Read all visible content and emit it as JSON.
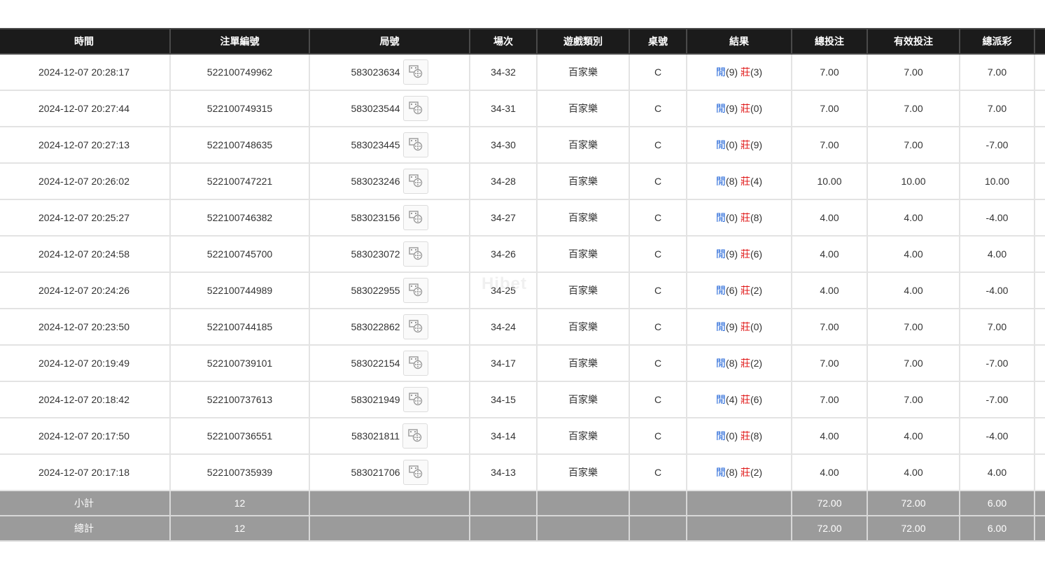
{
  "headers": [
    "時間",
    "注單編號",
    "局號",
    "場次",
    "遊戲類別",
    "桌號",
    "結果",
    "總投注",
    "有效投注",
    "總派彩",
    ""
  ],
  "rows": [
    {
      "time": "2024-12-07 20:28:17",
      "bet_no": "522100749962",
      "round": "583023634",
      "shoe": "34-32",
      "game": "百家樂",
      "table": "C",
      "p_label": "閒",
      "p_val": "(9)",
      "b_label": "莊",
      "b_val": "(3)",
      "total_bet": "7.00",
      "valid_bet": "7.00",
      "payout": "7.00"
    },
    {
      "time": "2024-12-07 20:27:44",
      "bet_no": "522100749315",
      "round": "583023544",
      "shoe": "34-31",
      "game": "百家樂",
      "table": "C",
      "p_label": "閒",
      "p_val": "(9)",
      "b_label": "莊",
      "b_val": "(0)",
      "total_bet": "7.00",
      "valid_bet": "7.00",
      "payout": "7.00"
    },
    {
      "time": "2024-12-07 20:27:13",
      "bet_no": "522100748635",
      "round": "583023445",
      "shoe": "34-30",
      "game": "百家樂",
      "table": "C",
      "p_label": "閒",
      "p_val": "(0)",
      "b_label": "莊",
      "b_val": "(9)",
      "total_bet": "7.00",
      "valid_bet": "7.00",
      "payout": "-7.00"
    },
    {
      "time": "2024-12-07 20:26:02",
      "bet_no": "522100747221",
      "round": "583023246",
      "shoe": "34-28",
      "game": "百家樂",
      "table": "C",
      "p_label": "閒",
      "p_val": "(8)",
      "b_label": "莊",
      "b_val": "(4)",
      "total_bet": "10.00",
      "valid_bet": "10.00",
      "payout": "10.00"
    },
    {
      "time": "2024-12-07 20:25:27",
      "bet_no": "522100746382",
      "round": "583023156",
      "shoe": "34-27",
      "game": "百家樂",
      "table": "C",
      "p_label": "閒",
      "p_val": "(0)",
      "b_label": "莊",
      "b_val": "(8)",
      "total_bet": "4.00",
      "valid_bet": "4.00",
      "payout": "-4.00"
    },
    {
      "time": "2024-12-07 20:24:58",
      "bet_no": "522100745700",
      "round": "583023072",
      "shoe": "34-26",
      "game": "百家樂",
      "table": "C",
      "p_label": "閒",
      "p_val": "(9)",
      "b_label": "莊",
      "b_val": "(6)",
      "total_bet": "4.00",
      "valid_bet": "4.00",
      "payout": "4.00"
    },
    {
      "time": "2024-12-07 20:24:26",
      "bet_no": "522100744989",
      "round": "583022955",
      "shoe": "34-25",
      "game": "百家樂",
      "table": "C",
      "p_label": "閒",
      "p_val": "(6)",
      "b_label": "莊",
      "b_val": "(2)",
      "total_bet": "4.00",
      "valid_bet": "4.00",
      "payout": "-4.00"
    },
    {
      "time": "2024-12-07 20:23:50",
      "bet_no": "522100744185",
      "round": "583022862",
      "shoe": "34-24",
      "game": "百家樂",
      "table": "C",
      "p_label": "閒",
      "p_val": "(9)",
      "b_label": "莊",
      "b_val": "(0)",
      "total_bet": "7.00",
      "valid_bet": "7.00",
      "payout": "7.00"
    },
    {
      "time": "2024-12-07 20:19:49",
      "bet_no": "522100739101",
      "round": "583022154",
      "shoe": "34-17",
      "game": "百家樂",
      "table": "C",
      "p_label": "閒",
      "p_val": "(8)",
      "b_label": "莊",
      "b_val": "(2)",
      "total_bet": "7.00",
      "valid_bet": "7.00",
      "payout": "-7.00"
    },
    {
      "time": "2024-12-07 20:18:42",
      "bet_no": "522100737613",
      "round": "583021949",
      "shoe": "34-15",
      "game": "百家樂",
      "table": "C",
      "p_label": "閒",
      "p_val": "(4)",
      "b_label": "莊",
      "b_val": "(6)",
      "total_bet": "7.00",
      "valid_bet": "7.00",
      "payout": "-7.00"
    },
    {
      "time": "2024-12-07 20:17:50",
      "bet_no": "522100736551",
      "round": "583021811",
      "shoe": "34-14",
      "game": "百家樂",
      "table": "C",
      "p_label": "閒",
      "p_val": "(0)",
      "b_label": "莊",
      "b_val": "(8)",
      "total_bet": "4.00",
      "valid_bet": "4.00",
      "payout": "-4.00"
    },
    {
      "time": "2024-12-07 20:17:18",
      "bet_no": "522100735939",
      "round": "583021706",
      "shoe": "34-13",
      "game": "百家樂",
      "table": "C",
      "p_label": "閒",
      "p_val": "(8)",
      "b_label": "莊",
      "b_val": "(2)",
      "total_bet": "4.00",
      "valid_bet": "4.00",
      "payout": "4.00"
    }
  ],
  "subtotal": {
    "label": "小計",
    "count": "12",
    "total_bet": "72.00",
    "valid_bet": "72.00",
    "payout": "6.00"
  },
  "grandtotal": {
    "label": "總計",
    "count": "12",
    "total_bet": "72.00",
    "valid_bet": "72.00",
    "payout": "6.00"
  },
  "watermark": "Hibet",
  "colors": {
    "header_bg": "#1b1b1b",
    "footer_bg": "#9b9b9b",
    "bet_blue": "#1a5fd6",
    "loss_red": "#e01b1b"
  }
}
